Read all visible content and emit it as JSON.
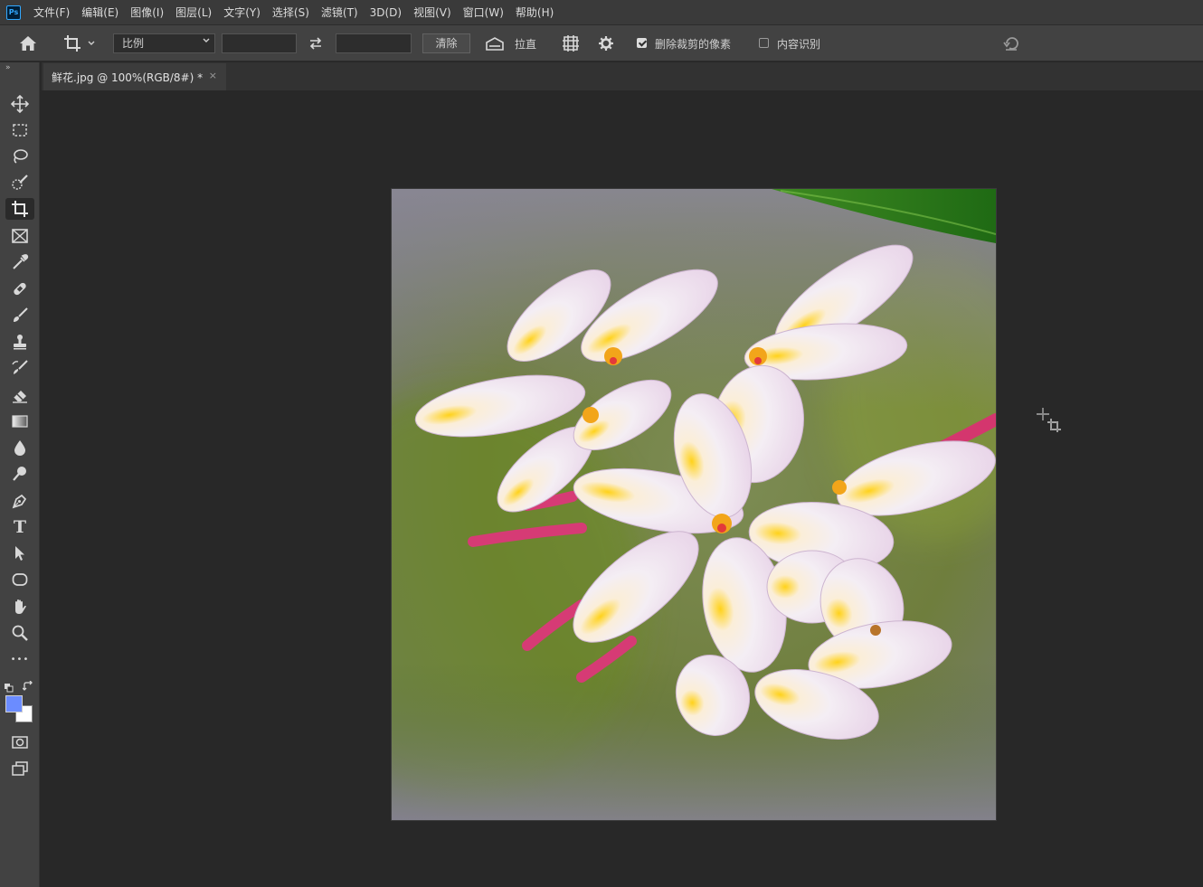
{
  "app": {
    "logo": "Ps"
  },
  "menu": [
    {
      "label": "文件(F)"
    },
    {
      "label": "编辑(E)"
    },
    {
      "label": "图像(I)"
    },
    {
      "label": "图层(L)"
    },
    {
      "label": "文字(Y)"
    },
    {
      "label": "选择(S)"
    },
    {
      "label": "滤镜(T)"
    },
    {
      "label": "3D(D)"
    },
    {
      "label": "视图(V)"
    },
    {
      "label": "窗口(W)"
    },
    {
      "label": "帮助(H)"
    }
  ],
  "options": {
    "ratio_select": "比例",
    "width_value": "",
    "height_value": "",
    "clear_label": "清除",
    "straighten_label": "拉直",
    "delete_cropped_label": "删除裁剪的像素",
    "delete_cropped_checked": true,
    "content_aware_label": "内容识别",
    "content_aware_checked": false
  },
  "document": {
    "tab_title": "鲜花.jpg @ 100%(RGB/8#) *",
    "close_symbol": "×"
  },
  "toolbar": {
    "collapse_symbol": "»",
    "tools": [
      {
        "name": "move-tool",
        "icon": "move-icon"
      },
      {
        "name": "marquee-tool",
        "icon": "rect-marquee-icon"
      },
      {
        "name": "lasso-tool",
        "icon": "lasso-icon"
      },
      {
        "name": "quick-select-tool",
        "icon": "quick-select-icon"
      },
      {
        "name": "crop-tool",
        "icon": "crop-icon",
        "active": true
      },
      {
        "name": "frame-tool",
        "icon": "frame-icon"
      },
      {
        "name": "eyedropper-tool",
        "icon": "eyedropper-icon"
      },
      {
        "name": "healing-tool",
        "icon": "bandage-icon"
      },
      {
        "name": "brush-tool",
        "icon": "brush-icon"
      },
      {
        "name": "stamp-tool",
        "icon": "stamp-icon"
      },
      {
        "name": "history-brush-tool",
        "icon": "history-brush-icon"
      },
      {
        "name": "eraser-tool",
        "icon": "eraser-icon"
      },
      {
        "name": "gradient-tool",
        "icon": "gradient-icon"
      },
      {
        "name": "blur-tool",
        "icon": "drop-icon"
      },
      {
        "name": "dodge-tool",
        "icon": "dodge-icon"
      },
      {
        "name": "pen-tool",
        "icon": "pen-icon"
      },
      {
        "name": "type-tool",
        "icon": "type-icon"
      },
      {
        "name": "path-select-tool",
        "icon": "arrow-icon"
      },
      {
        "name": "shape-tool",
        "icon": "rounded-rect-icon"
      },
      {
        "name": "hand-tool",
        "icon": "hand-icon"
      },
      {
        "name": "zoom-tool",
        "icon": "zoom-icon"
      },
      {
        "name": "more-tools",
        "icon": "ellipsis-icon"
      }
    ],
    "type_glyph": "T",
    "ellipsis_glyph": "•••",
    "foreground_color": "#6b8cff",
    "background_color": "#ffffff"
  },
  "colors": {
    "menubar": "#3a3a3a",
    "optionsbar": "#424242",
    "workspace": "#282828"
  }
}
